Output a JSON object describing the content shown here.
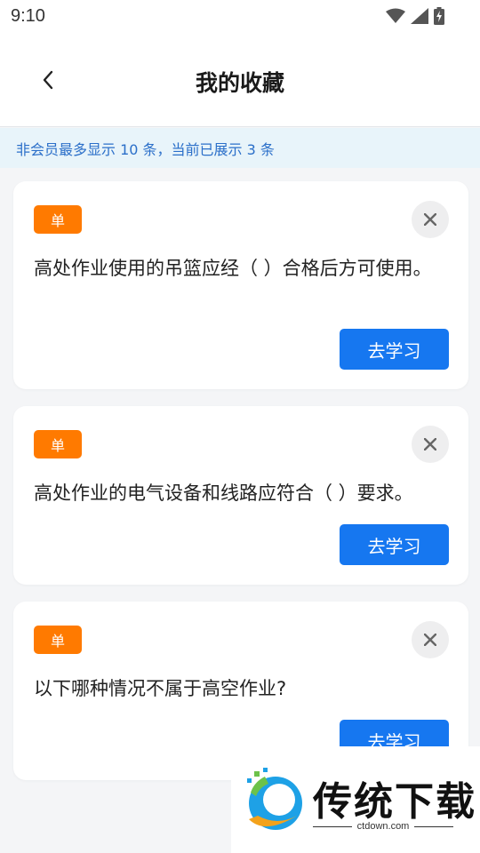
{
  "status_bar": {
    "time": "9:10",
    "icons": [
      "wifi-icon",
      "signal-icon",
      "battery-charging-icon"
    ]
  },
  "header": {
    "back_icon": "chevron-left-icon",
    "title": "我的收藏"
  },
  "notice": {
    "text": "非会员最多显示 10 条，当前已展示 3 条"
  },
  "cards": [
    {
      "tag": "单",
      "question": "高处作业使用的吊篮应经（ ）合格后方可使用。",
      "button": "去学习"
    },
    {
      "tag": "单",
      "question": "高处作业的电气设备和线路应符合（ ）要求。",
      "button": "去学习"
    },
    {
      "tag": "单",
      "question": "以下哪种情况不属于高空作业?",
      "button": "去学习"
    }
  ],
  "watermark": {
    "brand": "传统下载",
    "site": "ctdown.com"
  },
  "colors": {
    "accent": "#1677f0",
    "tag": "#ff7a00",
    "notice_bg": "#e8f4fa",
    "notice_text": "#2b6fc9"
  }
}
